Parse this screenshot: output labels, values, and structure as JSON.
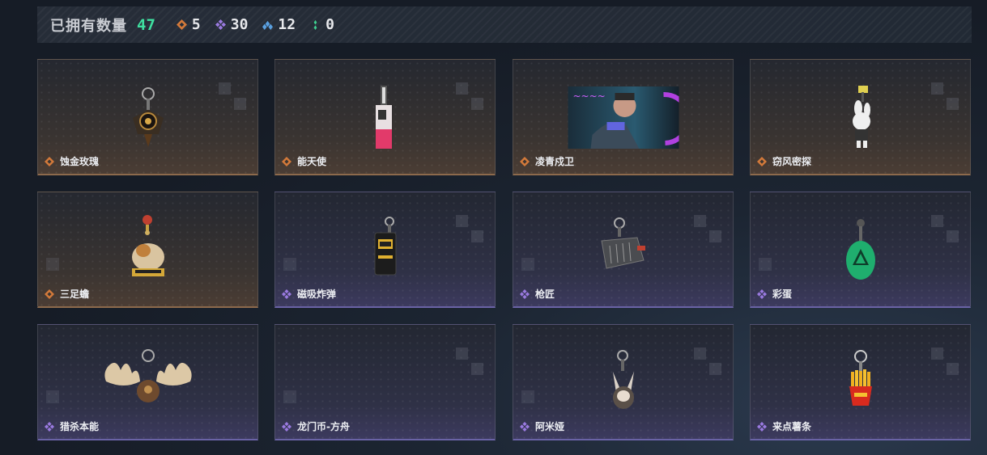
{
  "stats": {
    "owned_label": "已拥有数量",
    "owned_count": "47",
    "rarities": [
      {
        "icon": "orange-diamond-icon",
        "color": "#d47a3a",
        "count": "5"
      },
      {
        "icon": "purple-diamond-icon",
        "color": "#9a7ae0",
        "count": "30"
      },
      {
        "icon": "blue-chevrons-icon",
        "color": "#5aa0e0",
        "count": "12"
      },
      {
        "icon": "green-dots-icon",
        "color": "#3fd090",
        "count": "0"
      }
    ]
  },
  "items": [
    {
      "name": "蚀金玫瑰",
      "rarity": "orange"
    },
    {
      "name": "能天使",
      "rarity": "orange"
    },
    {
      "name": "凌青戍卫",
      "rarity": "orange"
    },
    {
      "name": "窃风密探",
      "rarity": "orange"
    },
    {
      "name": "三足蟾",
      "rarity": "orange"
    },
    {
      "name": "磁吸炸弹",
      "rarity": "purple"
    },
    {
      "name": "枪匠",
      "rarity": "purple"
    },
    {
      "name": "彩蛋",
      "rarity": "purple"
    },
    {
      "name": "猎杀本能",
      "rarity": "purple"
    },
    {
      "name": "龙门币-方舟",
      "rarity": "purple"
    },
    {
      "name": "阿米娅",
      "rarity": "purple"
    },
    {
      "name": "来点薯条",
      "rarity": "purple"
    }
  ],
  "colors": {
    "orange": "#d47a3a",
    "purple": "#9a7ae0",
    "accent_green": "#3fe0a0"
  }
}
